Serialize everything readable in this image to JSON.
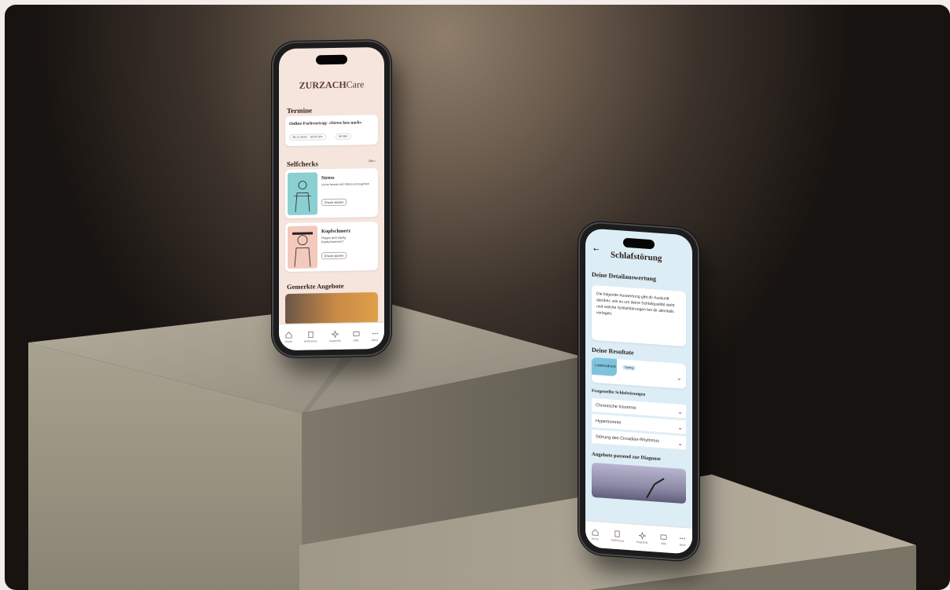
{
  "phone_left": {
    "brand": "ZURZACH",
    "brand_suffix": "Care",
    "termine": {
      "title": "Termine",
      "event_title": "Online-Fachvortrag: «Stress lass nach»",
      "date": "28.11.2023 · 18:00 Uhr",
      "duration": "60 Min."
    },
    "selfchecks": {
      "title": "Selfchecks",
      "more": "Alle ›",
      "items": [
        {
          "title": "Stress",
          "desc": "Lerne besser mit Stress umzugehen",
          "button": "Check starten"
        },
        {
          "title": "Kopfschmerz",
          "desc": "Plagen dich häufig Kopfschmerzen?",
          "button": "Check starten"
        }
      ]
    },
    "offers_title": "Gemerkte Angebote",
    "nav": [
      "Home",
      "Selfchecks",
      "Angebote",
      "Hilfe",
      "Mehr"
    ]
  },
  "phone_right": {
    "back": "←",
    "title": "Schlafstörung",
    "detail_title": "Deine Detailauswertung",
    "detail_text": "Die folgende Auswertung gibt dir Auskunft darüber, wie es um deine Schlafqualität steht und welche Schlafstörungen bei dir allenfalls vorlagen.",
    "results_title": "Deine Resultate",
    "pill_main": "Leidensdruck",
    "pill_tag": "Gering",
    "findings_title": "Festgestellte Schlafstörungen",
    "findings": [
      "Chronische Insomnie",
      "Hypersomnie",
      "Störung des Circadian-Rhythmus"
    ],
    "offers_title": "Angebote passend zur Diagnose",
    "nav": [
      "Home",
      "Selfchecks",
      "Angebote",
      "Hilfe",
      "Mehr"
    ]
  },
  "colors": {
    "left_screen_bg": "#f5e5dc",
    "right_screen_bg": "#dcedf5",
    "accent_teal": "#8ccfd2",
    "accent_blue": "#7ec3dc",
    "brand_brown": "#5a3a2a"
  }
}
